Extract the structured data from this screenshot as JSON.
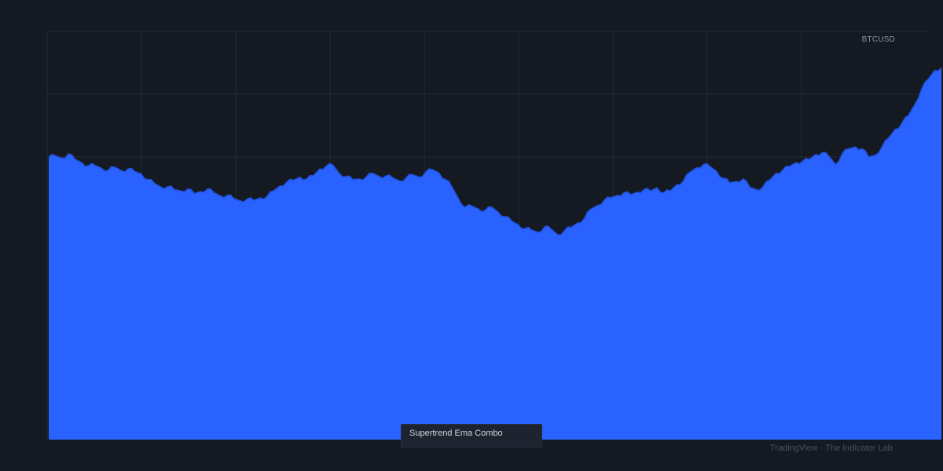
{
  "chart_data": {
    "type": "area",
    "title": "",
    "series": [
      {
        "name": "BTCUSD",
        "color": "#2962ff",
        "values": [
          45,
          45.2,
          44.8,
          45.5,
          44.6,
          44.1,
          43.6,
          43.7,
          43.2,
          42.9,
          43.4,
          42.8,
          43.1,
          42.7,
          42.3,
          41.4,
          40.8,
          40.2,
          40.3,
          39.8,
          39.6,
          39.9,
          39.2,
          39.5,
          39.9,
          39.3,
          38.8,
          38.9,
          38.4,
          38.0,
          38.3,
          38.1,
          38.5,
          38.7,
          39.6,
          40.4,
          41.0,
          41.3,
          41.8,
          41.5,
          42.0,
          43.1,
          43.6,
          43.7,
          42.3,
          41.9,
          41.4,
          41.5,
          41.8,
          42.4,
          41.9,
          42.0,
          41.7,
          41.2,
          41.6,
          42.2,
          41.8,
          42.6,
          43.0,
          42.5,
          41.4,
          40.2,
          38.3,
          37.0,
          37.2,
          36.7,
          36.5,
          37.0,
          36.2,
          35.5,
          34.8,
          34.2,
          33.6,
          33.4,
          33.0,
          33.9,
          33.5,
          32.6,
          33.3,
          33.8,
          34.5,
          35.2,
          36.7,
          37.3,
          38.1,
          38.5,
          38.9,
          39.3,
          39.0,
          39.4,
          39.8,
          39.6,
          40.1,
          39.3,
          39.6,
          40.6,
          41.2,
          42.6,
          43.3,
          43.8,
          43.5,
          42.7,
          41.6,
          40.9,
          41.1,
          41.5,
          40.2,
          39.8,
          40.2,
          41.3,
          42.4,
          42.9,
          43.5,
          44.1,
          44.3,
          44.6,
          45.4,
          45.7,
          45.1,
          43.8,
          45.5,
          46.3,
          46.6,
          46.3,
          45.0,
          45.3,
          46.6,
          48.0,
          49.4,
          50.3,
          51.6,
          53.4,
          55.8,
          57.4,
          58.8,
          59.2
        ]
      }
    ],
    "grid": true,
    "legend": "top-right"
  },
  "labels": {
    "symbol": "BTCUSD",
    "indicator": "Supertrend Ema Combo",
    "watermark": "TradingView · The Indicator Lab"
  },
  "colors": {
    "background": "#151922",
    "grid": "#242935",
    "area_fill": "#2962ff",
    "area_line": "#2150d6"
  }
}
